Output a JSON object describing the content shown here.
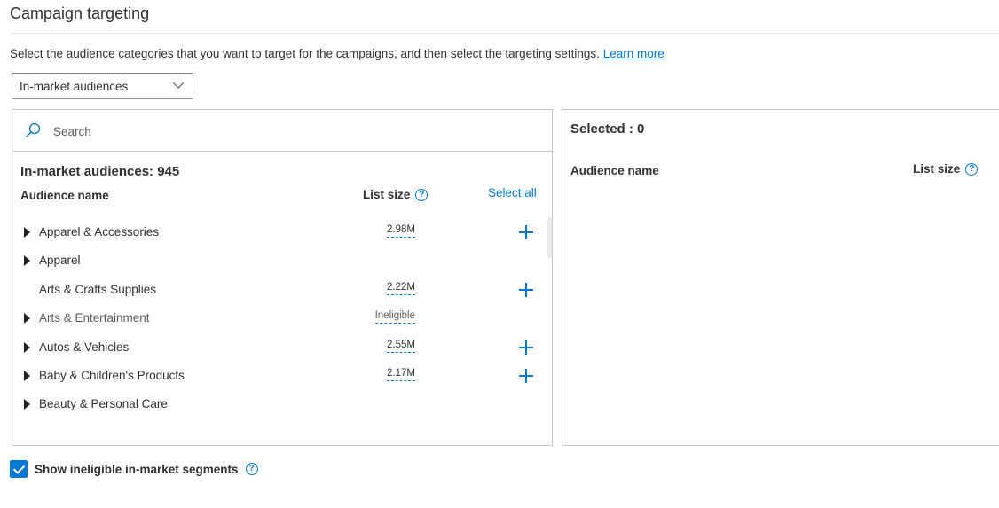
{
  "page": {
    "title": "Campaign targeting",
    "intro_text": "Select the audience categories that you want to target for the campaigns, and then select the targeting settings.",
    "learn_more": "Learn more"
  },
  "dropdown": {
    "selected": "In-market audiences",
    "icon": "chevron-down-icon"
  },
  "left_panel": {
    "search_placeholder": "Search",
    "search_value": "",
    "count_label": "In-market audiences:  945",
    "col_name": "Audience name",
    "col_size": "List size",
    "help_glyph": "?",
    "select_all": "Select all",
    "rows": [
      {
        "name": "Apparel & Accessories",
        "size": "2.98M",
        "expandable": true,
        "addable": true,
        "ineligible": false
      },
      {
        "name": "Apparel",
        "size": "",
        "expandable": true,
        "addable": false,
        "ineligible": false
      },
      {
        "name": "Arts & Crafts Supplies",
        "size": "2.22M",
        "expandable": false,
        "addable": true,
        "ineligible": false
      },
      {
        "name": "Arts & Entertainment",
        "size": "Ineligible",
        "expandable": true,
        "addable": false,
        "ineligible": true
      },
      {
        "name": "Autos & Vehicles",
        "size": "2.55M",
        "expandable": true,
        "addable": true,
        "ineligible": false
      },
      {
        "name": "Baby & Children's Products",
        "size": "2.17M",
        "expandable": true,
        "addable": true,
        "ineligible": false
      },
      {
        "name": "Beauty & Personal Care",
        "size": "",
        "expandable": true,
        "addable": false,
        "ineligible": false
      }
    ]
  },
  "right_panel": {
    "selected_label": "Selected :  0",
    "col_name": "Audience name",
    "col_size": "List size",
    "help_glyph": "?"
  },
  "footer": {
    "checkbox_label": "Show ineligible in-market segments",
    "checkbox_checked": true,
    "help_glyph": "?"
  },
  "colors": {
    "accent": "#0078d4",
    "text": "#323130",
    "border": "#c8c6c4"
  }
}
